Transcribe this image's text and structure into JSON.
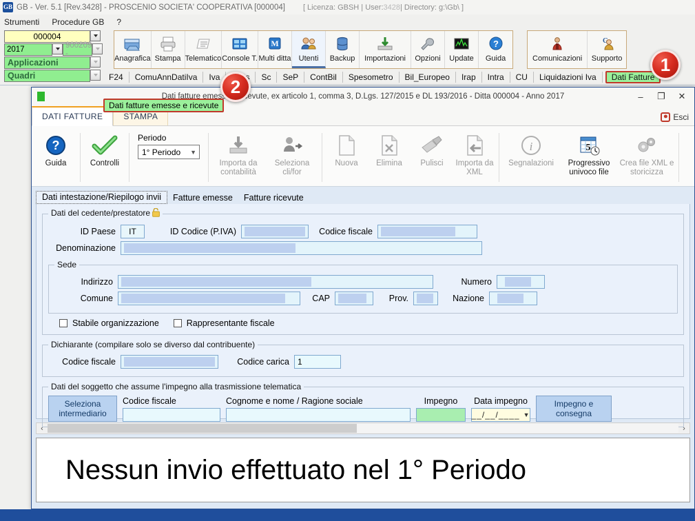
{
  "app": {
    "logo_text": "GB",
    "title": "GB - Ver. 5.1 [Rev.3428] -   PROSCENIO SOCIETA' COOPERATIVA [000004]",
    "license_pre": "[ Licenza: GBSH | User:",
    "license_user": "3428",
    "license_post": "| Directory: g:\\Gb\\ ]",
    "menu": [
      "Strumenti",
      "Procedure GB",
      "?"
    ],
    "selectors": {
      "ditta": "000004",
      "anno": "2017",
      "codice": "900209 -",
      "applicazioni": "Applicazioni",
      "quadri": "Quadri"
    },
    "toolbar_left": [
      {
        "label": "Anagrafica",
        "icon": "anagrafica-icon"
      },
      {
        "label": "Stampa",
        "icon": "printer-icon"
      },
      {
        "label": "Telematico",
        "icon": "telematico-icon"
      },
      {
        "label": "Console T.",
        "icon": "console-icon"
      },
      {
        "label": "Multi ditta",
        "icon": "multiditta-icon"
      },
      {
        "label": "Utenti",
        "icon": "users-icon"
      },
      {
        "label": "Backup",
        "icon": "backup-icon"
      },
      {
        "label": "Importazioni",
        "icon": "import-icon"
      },
      {
        "label": "Opzioni",
        "icon": "wrench-icon"
      },
      {
        "label": "Update",
        "icon": "update-icon"
      },
      {
        "label": "Guida",
        "icon": "help-icon"
      }
    ],
    "toolbar_right": [
      {
        "label": "Comunicazioni",
        "icon": "comunicazioni-icon"
      },
      {
        "label": "Supporto",
        "icon": "supporto-icon"
      }
    ],
    "app_tabs": [
      "F24",
      "ComuAnnDatiIva",
      "Iva",
      "770s",
      "Sc",
      "SeP",
      "ContBil",
      "Spesometro",
      "Bil_Europeo",
      "Irap",
      "Intra",
      "CU",
      "Liquidazioni Iva"
    ],
    "app_tab_active": "Dati Fatture",
    "quadri_selected": "Dati fatture emesse e ricevute",
    "badges": [
      {
        "id": "1",
        "label": "1"
      },
      {
        "id": "2",
        "label": "2"
      }
    ]
  },
  "child_window": {
    "title": "Dati fatture emesse e ricevute, ex articolo 1, comma 3, D.Lgs. 127/2015 e DL 193/2016 - Ditta 000004 - Anno 2017",
    "minimize": "–",
    "maximize": "❐",
    "close": "✕",
    "tabs": [
      {
        "label": "DATI FATTURE",
        "active": true
      },
      {
        "label": "STAMPA",
        "active": false
      }
    ],
    "esci": "Esci",
    "ribbon": {
      "guida": "Guida",
      "controlli": "Controlli",
      "periodo_label": "Periodo",
      "periodo_value": "1° Periodo",
      "importa_contabilita": "Importa da contabilità",
      "seleziona_clifor": "Seleziona cli/for",
      "nuova": "Nuova",
      "elimina": "Elimina",
      "pulisci": "Pulisci",
      "importa_xml": "Importa da XML",
      "segnalazioni": "Segnalazioni",
      "progressivo": "Progressivo univoco file",
      "crea_xml": "Crea file XML e storicizza"
    },
    "form_tabs": [
      {
        "label": "Dati intestazione/Riepilogo invii",
        "active": true
      },
      {
        "label": "Fatture emesse",
        "active": false
      },
      {
        "label": "Fatture ricevute",
        "active": false
      }
    ],
    "form": {
      "cedente_legend": "Dati del cedente/prestatore",
      "id_paese_label": "ID Paese",
      "id_paese_value": "IT",
      "id_codice_label": "ID Codice (P.IVA)",
      "id_codice_value": "",
      "codice_fiscale_label": "Codice fiscale",
      "codice_fiscale_value": "",
      "denominazione_label": "Denominazione",
      "denominazione_value": "",
      "sede_legend": "Sede",
      "indirizzo_label": "Indirizzo",
      "indirizzo_value": "",
      "numero_label": "Numero",
      "numero_value": "",
      "comune_label": "Comune",
      "comune_value": "",
      "cap_label": "CAP",
      "cap_value": "",
      "prov_label": "Prov.",
      "prov_value": "",
      "nazione_label": "Nazione",
      "nazione_value": "",
      "stabile_org": "Stabile organizzazione",
      "rappr_fiscale": "Rappresentante fiscale",
      "dichiarante_legend": "Dichiarante (compilare solo se diverso dal contribuente)",
      "dich_cf_label": "Codice fiscale",
      "dich_cf_value": "",
      "codice_carica_label": "Codice carica",
      "codice_carica_value": "1",
      "impegno_legend": "Dati del soggetto che assume l'impegno alla trasmissione telematica",
      "seleziona_intermediario": "Seleziona intermediario",
      "int_cf_label": "Codice fiscale",
      "int_cf_value": "",
      "cognome_label": "Cognome e nome / Ragione sociale",
      "cognome_value": "",
      "impegno_label": "Impegno",
      "impegno_value": "",
      "data_impegno_label": "Data impegno",
      "data_impegno_value": "__/__/____",
      "impegno_consegna": "Impegno e consegna"
    },
    "scroll": {
      "left_arrow": "‹",
      "right_arrow": "›"
    },
    "message": "Nessun invio effettuato nel 1° Periodo"
  },
  "colors": {
    "accent_blue": "#1f4e9c",
    "highlight_green": "#9bf09b",
    "highlight_red": "#c0392b",
    "field_blue": "#bdd0ef",
    "field_bg": "#e3f4fb",
    "impegno_green": "#a9eeb0"
  }
}
